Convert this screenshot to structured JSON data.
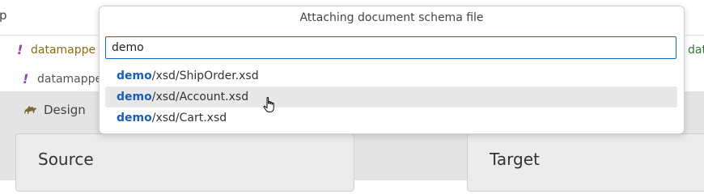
{
  "background": {
    "top_glyph": "p",
    "rows": [
      {
        "marker": "!",
        "name": "datamappe",
        "trailing": "dat"
      },
      {
        "marker": "!",
        "name": "datamappe"
      }
    ],
    "design_tab_label": "Design",
    "source_panel_title": "Source",
    "target_panel_title": "Target"
  },
  "quick_pick": {
    "title": "Attaching document schema file",
    "input_value": "demo",
    "items": [
      {
        "match": "demo",
        "rest": "/xsd/ShipOrder.xsd",
        "selected": false
      },
      {
        "match": "demo",
        "rest": "/xsd/Account.xsd",
        "selected": true
      },
      {
        "match": "demo",
        "rest": "/xsd/Cart.xsd",
        "selected": false
      }
    ]
  },
  "colors": {
    "accent": "#0f6cbd",
    "match_highlight": "#1a5fb4",
    "selected_row": "#e8e8e8"
  }
}
